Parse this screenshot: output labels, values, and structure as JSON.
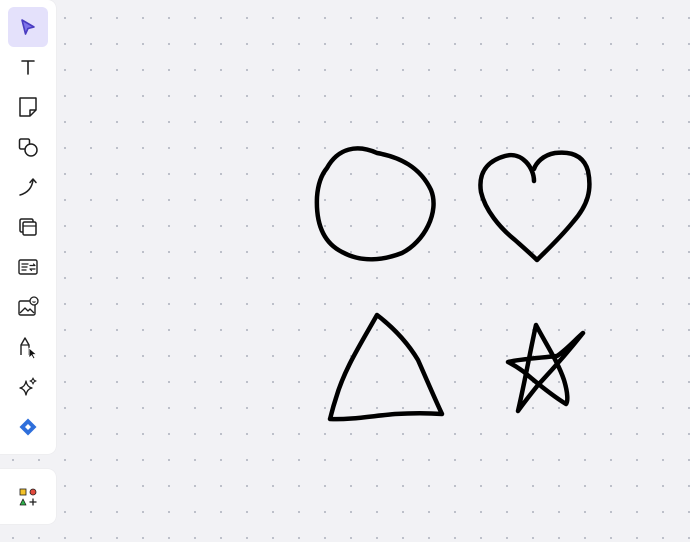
{
  "toolbar": {
    "tools": [
      {
        "id": "select",
        "icon": "select-cursor-icon",
        "active": true
      },
      {
        "id": "text",
        "icon": "text-icon",
        "active": false
      },
      {
        "id": "sticky-note",
        "icon": "sticky-note-icon",
        "active": false
      },
      {
        "id": "shapes",
        "icon": "shapes-icon",
        "active": false
      },
      {
        "id": "connector",
        "icon": "connector-arrow-icon",
        "active": false
      },
      {
        "id": "frame",
        "icon": "frame-icon",
        "active": false
      },
      {
        "id": "card",
        "icon": "card-icon",
        "active": false
      },
      {
        "id": "image",
        "icon": "image-icon",
        "active": false
      },
      {
        "id": "pen",
        "icon": "pen-icon",
        "active": false
      },
      {
        "id": "ai",
        "icon": "sparkle-icon",
        "active": false
      },
      {
        "id": "jira",
        "icon": "jira-diamond-icon",
        "active": false
      }
    ],
    "accent_color": "#5e4dcf"
  },
  "library": {
    "icon": "shape-library-icon"
  },
  "canvas": {
    "background": "#f2f2f5",
    "drawings": [
      "circle",
      "heart",
      "triangle",
      "star"
    ],
    "stroke_color": "#000000"
  }
}
